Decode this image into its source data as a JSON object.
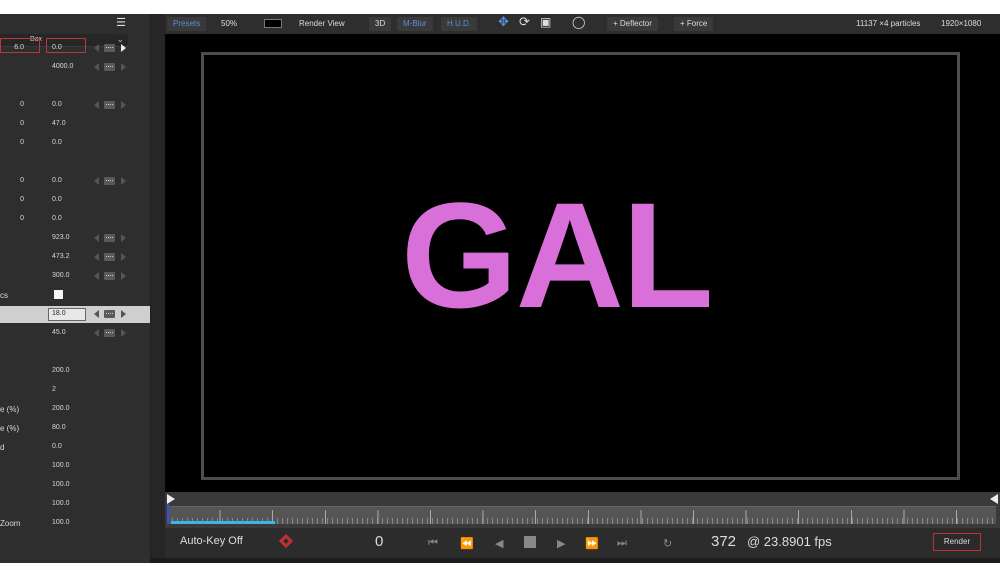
{
  "left_panel": {
    "menu_icon": "hamburger-menu-icon",
    "emitter_shape": "Box",
    "rows": [
      {
        "label": "",
        "c1": "6.0",
        "c2": "0.0",
        "key": "play"
      },
      {
        "label": "",
        "c1": "",
        "c2": "4000.0",
        "key": "key"
      },
      {
        "label": "",
        "c1": "0",
        "c2": "0.0",
        "key": "key"
      },
      {
        "label": "",
        "c1": "0",
        "c2": "47.0",
        "key": ""
      },
      {
        "label": "",
        "c1": "0",
        "c2": "0.0",
        "key": ""
      },
      {
        "label": "",
        "c1": "0",
        "c2": "0.0",
        "key": "key"
      },
      {
        "label": "",
        "c1": "0",
        "c2": "0.0",
        "key": ""
      },
      {
        "label": "",
        "c1": "0",
        "c2": "0.0",
        "key": ""
      },
      {
        "label": "",
        "c1": "",
        "c2": "923.0",
        "key": "key"
      },
      {
        "label": "",
        "c1": "",
        "c2": "473.2",
        "key": "key"
      },
      {
        "label": "",
        "c1": "",
        "c2": "300.0",
        "key": "key"
      },
      {
        "label": "cs",
        "c1": "",
        "c2": "",
        "key": "checkbox"
      },
      {
        "label": "",
        "c1": "",
        "c2": "18.0",
        "key": "key"
      },
      {
        "label": "",
        "c1": "",
        "c2": "45.0",
        "key": "key"
      },
      {
        "label": "",
        "c1": "",
        "c2": "",
        "key": ""
      },
      {
        "label": "",
        "c1": "",
        "c2": "200.0",
        "key": ""
      },
      {
        "label": "",
        "c1": "",
        "c2": "2",
        "key": ""
      },
      {
        "label": "e (%)",
        "c1": "",
        "c2": "200.0",
        "key": ""
      },
      {
        "label": "e (%)",
        "c1": "",
        "c2": "80.0",
        "key": ""
      },
      {
        "label": "d",
        "c1": "",
        "c2": "0.0",
        "key": ""
      },
      {
        "label": "",
        "c1": "",
        "c2": "100.0",
        "key": ""
      },
      {
        "label": "",
        "c1": "",
        "c2": "100.0",
        "key": ""
      },
      {
        "label": "",
        "c1": "",
        "c2": "100.0",
        "key": ""
      },
      {
        "label": "Zoom",
        "c1": "",
        "c2": "100.0",
        "key": ""
      }
    ]
  },
  "toolbar": {
    "presets": "Presets",
    "zoom": "50%",
    "render_view": "Render View",
    "three_d": "3D",
    "mblur": "M-Blur",
    "hud": "H.U.D.",
    "deflector": "+ Deflector",
    "force": "+ Force",
    "particles": "11137 ×4 particles",
    "resolution": "1920×1080",
    "icons": [
      "move-icon",
      "rotate-icon",
      "scale-icon",
      "globe-icon"
    ]
  },
  "viewport": {
    "text": "GAL",
    "text_color": "#d96fd8"
  },
  "transport": {
    "autokey": "Auto-Key Off",
    "current_frame": "0",
    "end_frame": "372",
    "fps_text": "@ 23.8901 fps",
    "render": "Render",
    "controls": [
      "skip-start-icon",
      "fast-rewind-icon",
      "step-back-icon",
      "stop-icon",
      "play-icon",
      "fast-forward-icon",
      "skip-end-icon",
      "loop-icon"
    ]
  }
}
